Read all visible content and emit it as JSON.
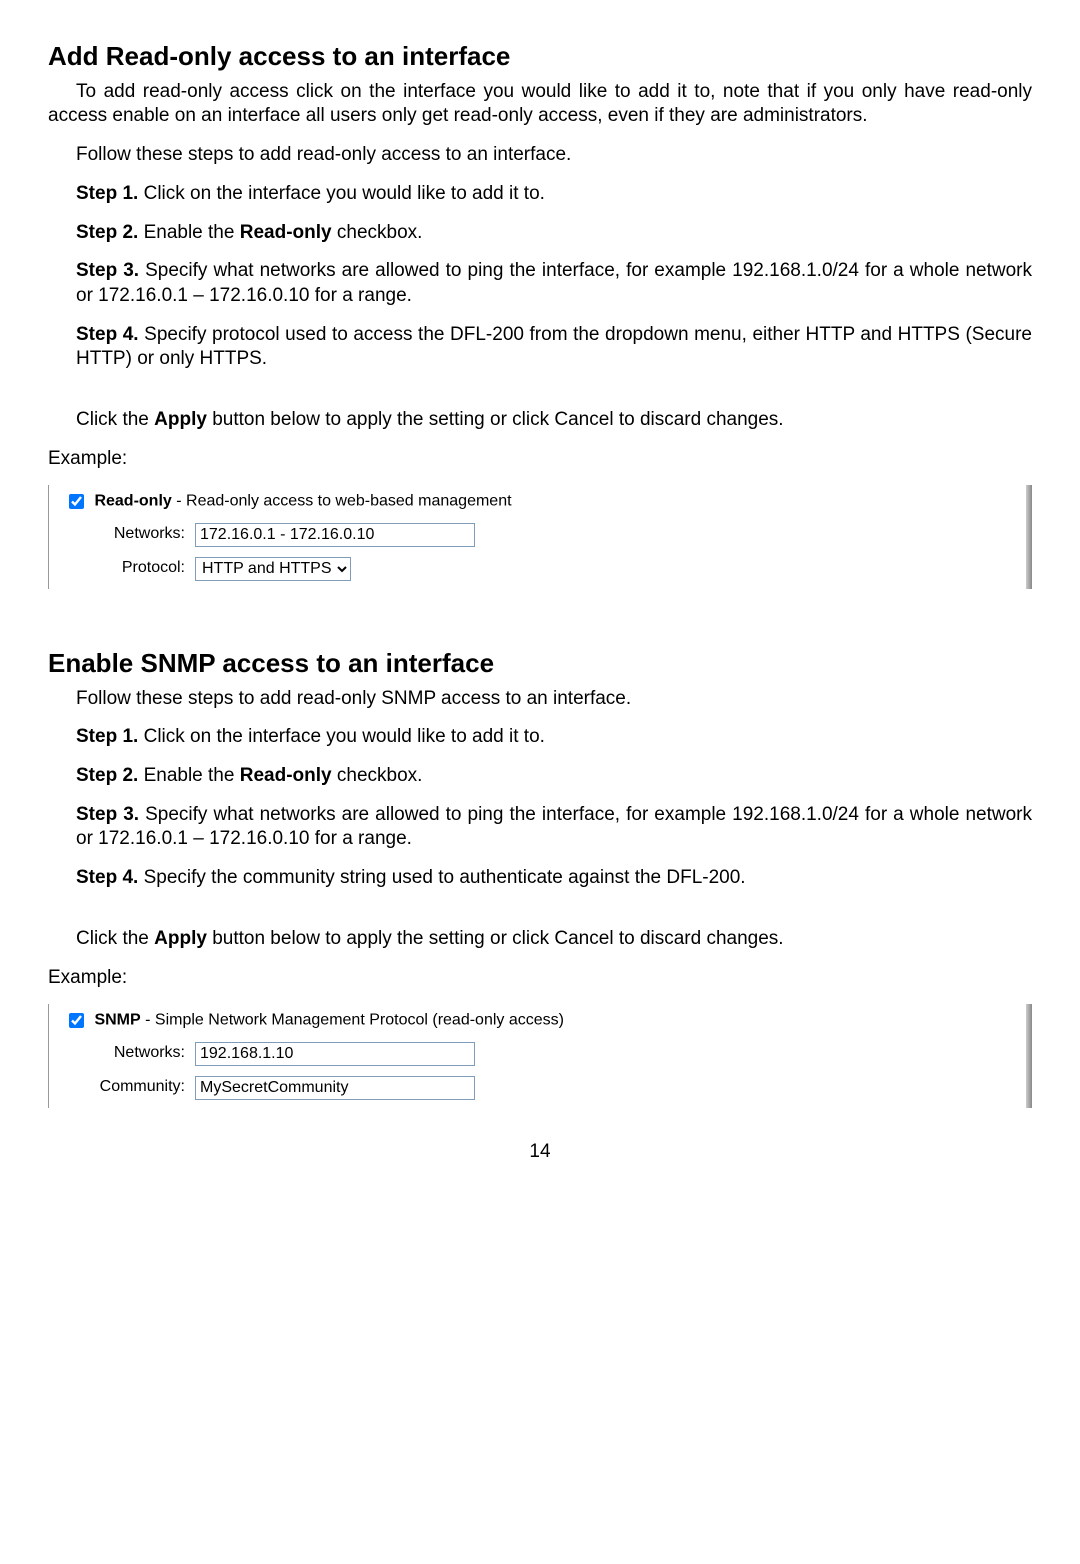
{
  "section1": {
    "heading": "Add Read-only access to an interface",
    "intro": "To add read-only access click on the interface you would like to add it to, note that if you only have read-only access enable on an interface all users only get read-only access, even if they are administrators.",
    "follow": "Follow these steps to add read-only access to an interface.",
    "step1_prefix": "Step 1.",
    "step1_rest": " Click on the interface you would like to add it to.",
    "step2_prefix": "Step 2.",
    "step2_a": " Enable the ",
    "step2_bold": "Read-only",
    "step2_b": " checkbox.",
    "step3_prefix": "Step 3.",
    "step3_rest": " Specify what networks are allowed to ping the interface, for example 192.168.1.0/24 for a whole network or 172.16.0.1 – 172.16.0.10 for a range.",
    "step4_prefix": "Step 4.",
    "step4_rest": " Specify protocol used to access the DFL-200 from the dropdown menu, either HTTP and HTTPS (Secure HTTP) or only HTTPS.",
    "apply_a": "Click the ",
    "apply_bold": "Apply",
    "apply_b": " button below to apply the setting or click Cancel to discard changes.",
    "example_label": "Example:",
    "box": {
      "chk_bold": "Read-only",
      "chk_rest": " - Read-only access to web-based management",
      "networks_label": "Networks:",
      "networks_value": "172.16.0.1 - 172.16.0.10",
      "protocol_label": "Protocol:",
      "protocol_value": "HTTP and HTTPS"
    }
  },
  "section2": {
    "heading": "Enable SNMP access to an interface",
    "follow": "Follow these steps to add read-only SNMP access to an interface.",
    "step1_prefix": "Step 1.",
    "step1_rest": " Click on the interface you would like to add it to.",
    "step2_prefix": "Step 2.",
    "step2_a": " Enable the ",
    "step2_bold": "Read-only",
    "step2_b": " checkbox.",
    "step3_prefix": "Step 3.",
    "step3_rest": " Specify what networks are allowed to ping the interface, for example 192.168.1.0/24 for a whole network or 172.16.0.1 – 172.16.0.10 for a range.",
    "step4_prefix": "Step 4.",
    "step4_rest": " Specify the community string used to authenticate against the DFL-200.",
    "apply_a": "Click the ",
    "apply_bold": "Apply",
    "apply_b": " button below to apply the setting or click Cancel to discard changes.",
    "example_label": "Example:",
    "box": {
      "chk_bold": "SNMP",
      "chk_rest": " - Simple Network Management Protocol (read-only access)",
      "networks_label": "Networks:",
      "networks_value": "192.168.1.10",
      "community_label": "Community:",
      "community_value": "MySecretCommunity"
    }
  },
  "page_number": "14"
}
